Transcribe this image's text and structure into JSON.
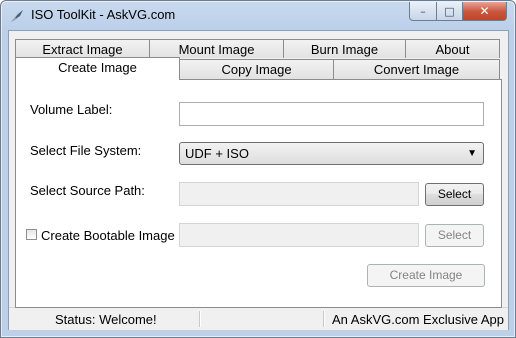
{
  "window": {
    "title": "ISO ToolKit - AskVG.com",
    "controls": {
      "minimize": "–",
      "maximize": "□",
      "close": "✕"
    }
  },
  "tabs": {
    "row_back": [
      "Extract Image",
      "Mount Image",
      "Burn Image",
      "About"
    ],
    "row_front": [
      "Create Image",
      "Copy Image",
      "Convert Image"
    ],
    "active": "Create Image"
  },
  "form": {
    "volume_label": {
      "label": "Volume Label:",
      "value": ""
    },
    "file_system": {
      "label": "Select File System:",
      "value": "UDF + ISO"
    },
    "source_path": {
      "label": "Select Source Path:",
      "value": "",
      "button": "Select"
    },
    "bootable": {
      "label": "Create Bootable Image",
      "checked": false,
      "value": "",
      "button": "Select"
    },
    "create_button": "Create Image"
  },
  "status": {
    "text": "Status: Welcome!",
    "right_text": "An AskVG.com Exclusive App"
  }
}
